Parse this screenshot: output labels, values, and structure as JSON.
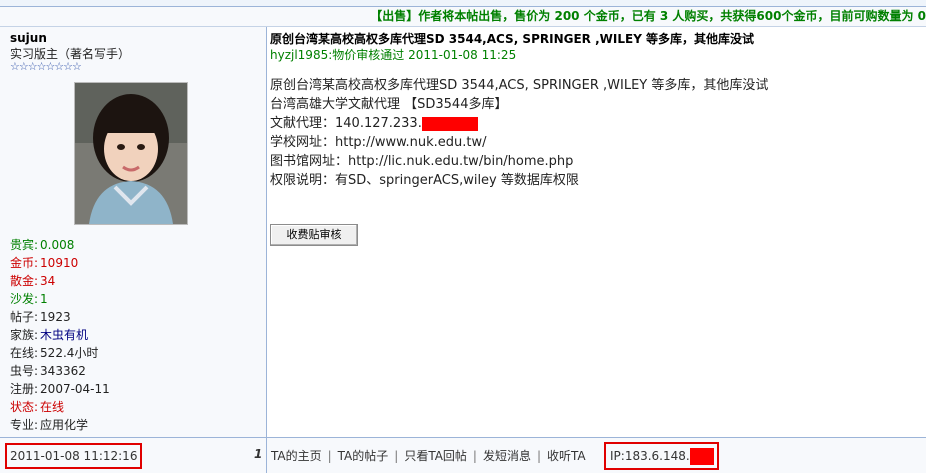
{
  "sale_banner": "【出售】作者将本帖出售，售价为 200 个金币，已有 3 人购买，共获得600个金币，目前可购数量为 0",
  "user": {
    "name": "sujun",
    "role": "实习版主（著名写手）",
    "stars": "☆☆☆☆☆☆☆☆",
    "stats": [
      {
        "label": "贵宾:",
        "value": "0.008",
        "color": "#008000"
      },
      {
        "label": "金币:",
        "value": "10910",
        "color": "#cc0000"
      },
      {
        "label": "散金:",
        "value": "34",
        "color": "#cc0000"
      },
      {
        "label": "沙发:",
        "value": "1",
        "color": "#008000"
      },
      {
        "label": "帖子:",
        "value": "1923",
        "color": "#222222"
      },
      {
        "label": "家族:",
        "value": "木虫有机",
        "color": "#000080"
      },
      {
        "label": "在线:",
        "value": "522.4小时",
        "color": "#222222"
      },
      {
        "label": "虫号:",
        "value": "343362",
        "color": "#222222"
      },
      {
        "label": "注册:",
        "value": "2007-04-11",
        "color": "#222222"
      },
      {
        "label": "状态:",
        "value": "在线",
        "color": "#cc0000"
      },
      {
        "label": "专业:",
        "value": "应用化学",
        "color": "#222222"
      }
    ]
  },
  "post": {
    "title": "原创台湾某高校高权多库代理SD 3544,ACS, SPRINGER ,WILEY 等多库，其他库没试",
    "audit": "hyzjl1985:物价审核通过  2011-01-08 11:25",
    "lines": [
      "原创台湾某高校高权多库代理SD 3544,ACS, SPRINGER ,WILEY 等多库，其他库没试",
      "台湾高雄大学文献代理 【SD3544多库】",
      "文献代理：140.127.233.",
      "学校网址：http://www.nuk.edu.tw/",
      "图书馆网址：http://lic.nuk.edu.tw/bin/home.php",
      "权限说明：有SD、springerACS,wiley 等数据库权限"
    ],
    "review_button": "收费贴审核"
  },
  "footer": {
    "timestamp": "2011-01-08 11:12:16",
    "floor": "1",
    "links": [
      "TA的主页",
      "TA的帖子",
      "只看TA回帖",
      "发短消息",
      "收听TA"
    ],
    "ip": "IP:183.6.148."
  }
}
